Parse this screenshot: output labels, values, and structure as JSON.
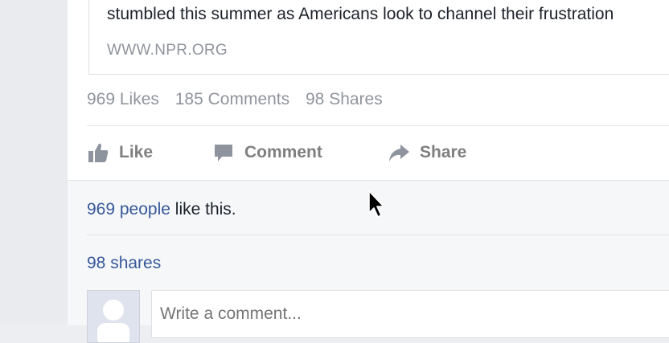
{
  "link_preview": {
    "description": "stumbled this summer as Americans look to channel their frustration",
    "domain": "WWW.NPR.ORG"
  },
  "stats": {
    "likes": "969 Likes",
    "comments": "185 Comments",
    "shares": "98 Shares"
  },
  "actions": {
    "like_label": "Like",
    "comment_label": "Comment",
    "share_label": "Share"
  },
  "reactions": {
    "people_link": "969 people",
    "like_suffix": " like this."
  },
  "shares_link": "98 shares",
  "comment_box": {
    "placeholder": "Write a comment..."
  },
  "colors": {
    "link": "#365899",
    "muted": "#90949c",
    "action": "#7f7f7f"
  },
  "icons": [
    "thumbs-up-icon",
    "comment-icon",
    "share-icon",
    "mouse-cursor-icon",
    "avatar-silhouette-icon"
  ]
}
